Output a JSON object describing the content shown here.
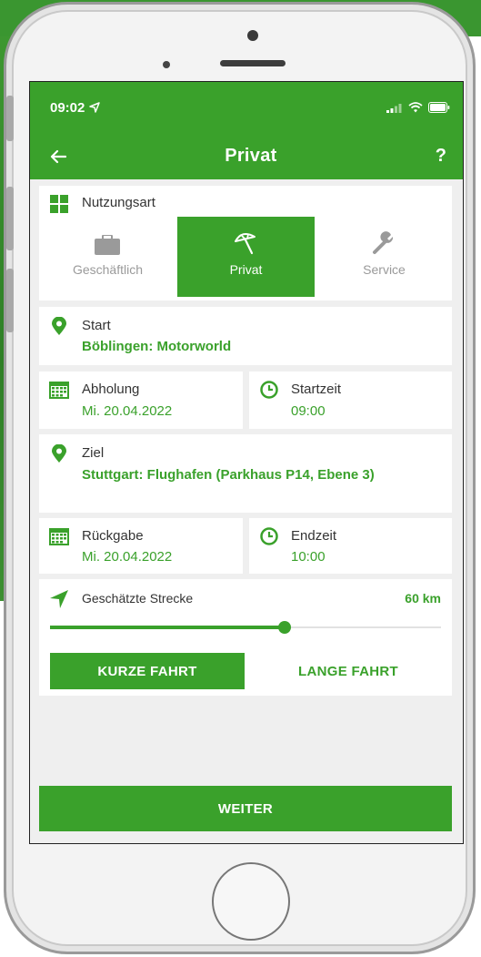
{
  "status_bar": {
    "time": "09:02"
  },
  "nav": {
    "back_icon": "arrow-left-icon",
    "title": "Privat",
    "help": "?"
  },
  "usage": {
    "heading": "Nutzungsart",
    "options": [
      {
        "label": "Geschäftlich",
        "icon": "briefcase-icon",
        "selected": false
      },
      {
        "label": "Privat",
        "icon": "umbrella-icon",
        "selected": true
      },
      {
        "label": "Service",
        "icon": "wrench-icon",
        "selected": false
      }
    ]
  },
  "start": {
    "label": "Start",
    "value": "Böblingen: Motorworld"
  },
  "pickup": {
    "date_label": "Abholung",
    "date_value": "Mi. 20.04.2022",
    "time_label": "Startzeit",
    "time_value": "09:00"
  },
  "destination": {
    "label": "Ziel",
    "value": "Stuttgart: Flughafen (Parkhaus P14, Ebene 3)"
  },
  "return": {
    "date_label": "Rückgabe",
    "date_value": "Mi. 20.04.2022",
    "time_label": "Endzeit",
    "time_value": "10:00"
  },
  "distance": {
    "label": "Geschätzte Strecke",
    "value": "60 km",
    "slider_fraction": 0.6,
    "short_trip": "KURZE FAHRT",
    "long_trip": "LANGE FAHRT"
  },
  "footer": {
    "next": "WEITER"
  },
  "colors": {
    "accent": "#3aa12b",
    "text": "#333333",
    "muted": "#9a9a9a"
  }
}
